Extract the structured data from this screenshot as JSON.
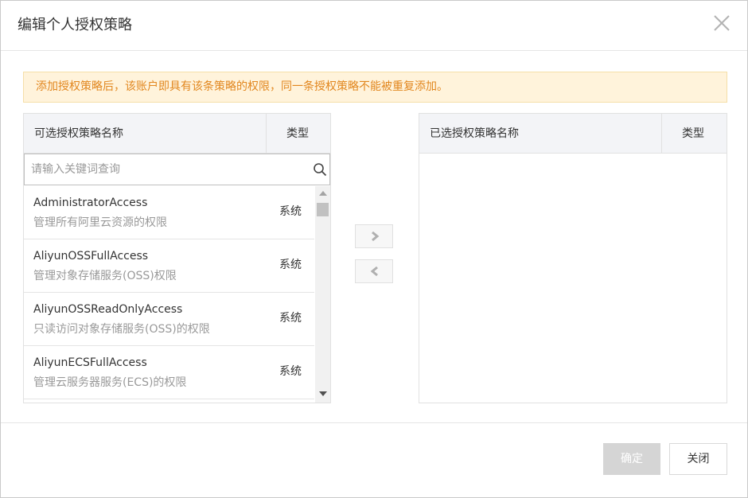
{
  "dialog": {
    "title": "编辑个人授权策略",
    "notice": "添加授权策略后，该账户即具有该条策略的权限，同一条授权策略不能被重复添加。"
  },
  "available_panel": {
    "header_name": "可选授权策略名称",
    "header_type": "类型",
    "search_placeholder": "请输入关键词查询",
    "search_value": "",
    "items": [
      {
        "name": "AdministratorAccess",
        "description": "管理所有阿里云资源的权限",
        "type": "系统"
      },
      {
        "name": "AliyunOSSFullAccess",
        "description": "管理对象存储服务(OSS)权限",
        "type": "系统"
      },
      {
        "name": "AliyunOSSReadOnlyAccess",
        "description": "只读访问对象存储服务(OSS)的权限",
        "type": "系统"
      },
      {
        "name": "AliyunECSFullAccess",
        "description": "管理云服务器服务(ECS)的权限",
        "type": "系统"
      }
    ]
  },
  "selected_panel": {
    "header_name": "已选授权策略名称",
    "header_type": "类型",
    "items": []
  },
  "transfer": {
    "add_icon": "chevron-right-icon",
    "remove_icon": "chevron-left-icon"
  },
  "footer": {
    "ok_label": "确定",
    "close_label": "关闭"
  },
  "colors": {
    "notice_bg": "#fff3db",
    "notice_text": "#e2871f",
    "disabled_button": "#d5d5d5"
  }
}
